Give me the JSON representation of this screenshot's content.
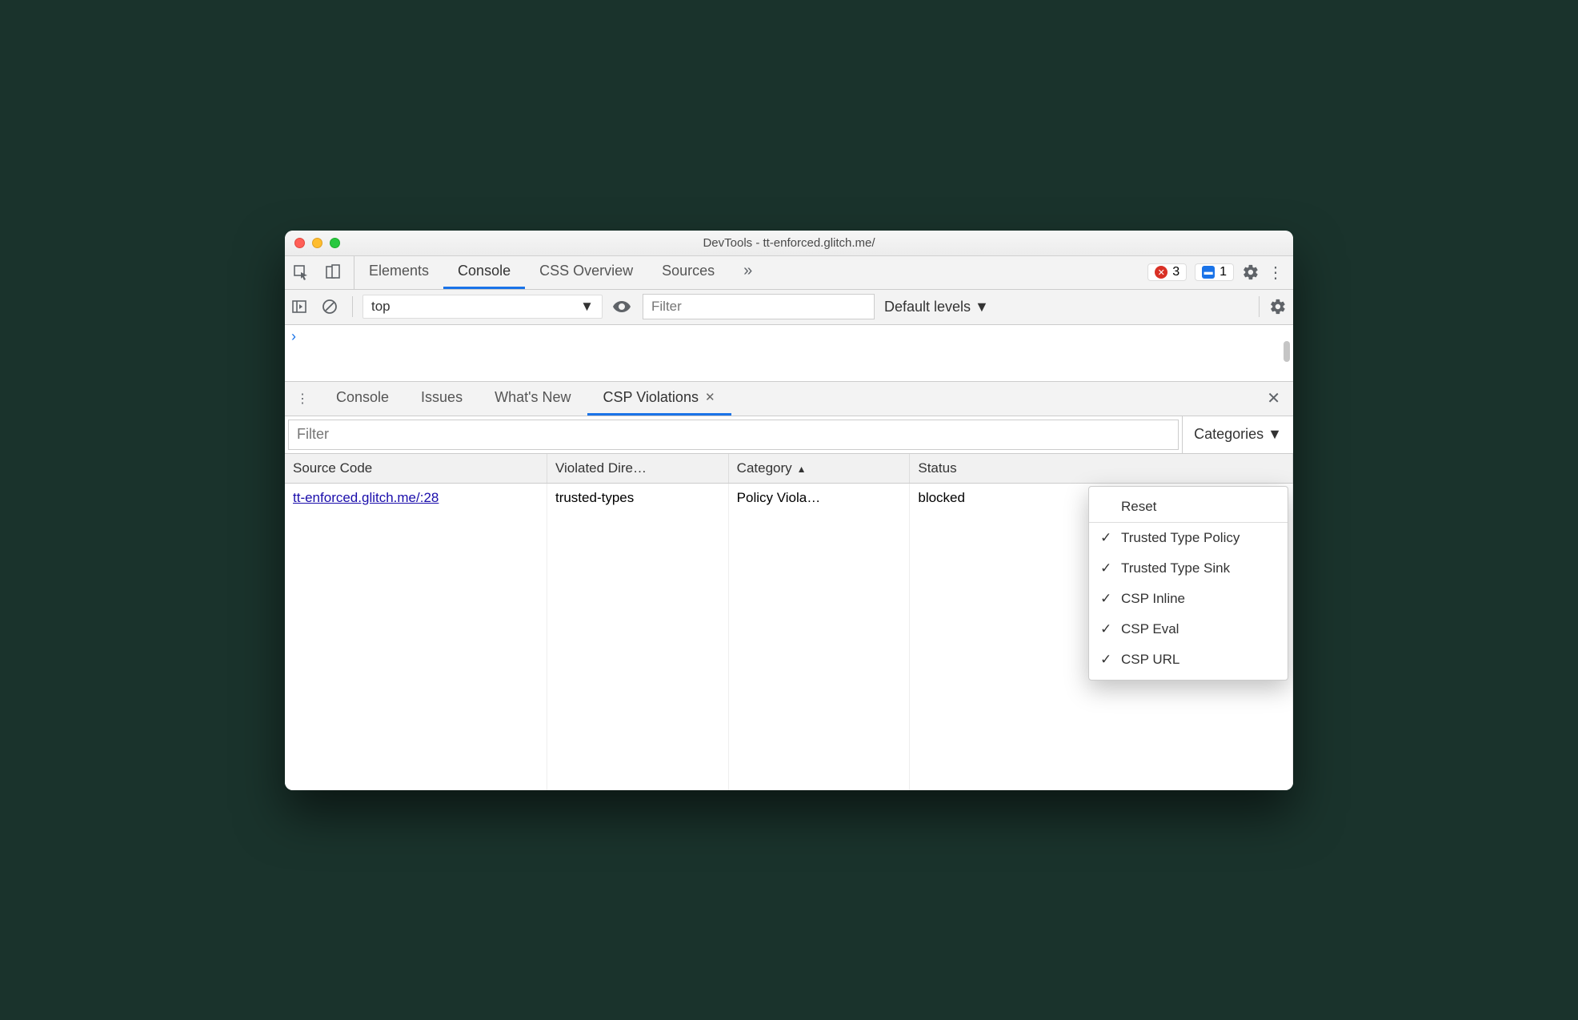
{
  "window": {
    "title": "DevTools - tt-enforced.glitch.me/"
  },
  "maintabs": {
    "items": [
      "Elements",
      "Console",
      "CSS Overview",
      "Sources"
    ],
    "active": "Console",
    "more_icon": "»"
  },
  "topright": {
    "error_count": "3",
    "message_count": "1"
  },
  "consolebar": {
    "context": "top",
    "filter_placeholder": "Filter",
    "levels": "Default levels ▼"
  },
  "drawer": {
    "tabs": [
      "Console",
      "Issues",
      "What's New",
      "CSP Violations"
    ],
    "active": "CSP Violations"
  },
  "filter": {
    "placeholder": "Filter",
    "categories_label": "Categories ▼"
  },
  "table": {
    "headers": {
      "source": "Source Code",
      "directive": "Violated Dire…",
      "category": "Category",
      "status": "Status"
    },
    "rows": [
      {
        "source": "tt-enforced.glitch.me/:28",
        "directive": "trusted-types",
        "category": "Policy Viola…",
        "status": "blocked"
      }
    ]
  },
  "dropdown": {
    "reset": "Reset",
    "items": [
      "Trusted Type Policy",
      "Trusted Type Sink",
      "CSP Inline",
      "CSP Eval",
      "CSP URL"
    ]
  }
}
